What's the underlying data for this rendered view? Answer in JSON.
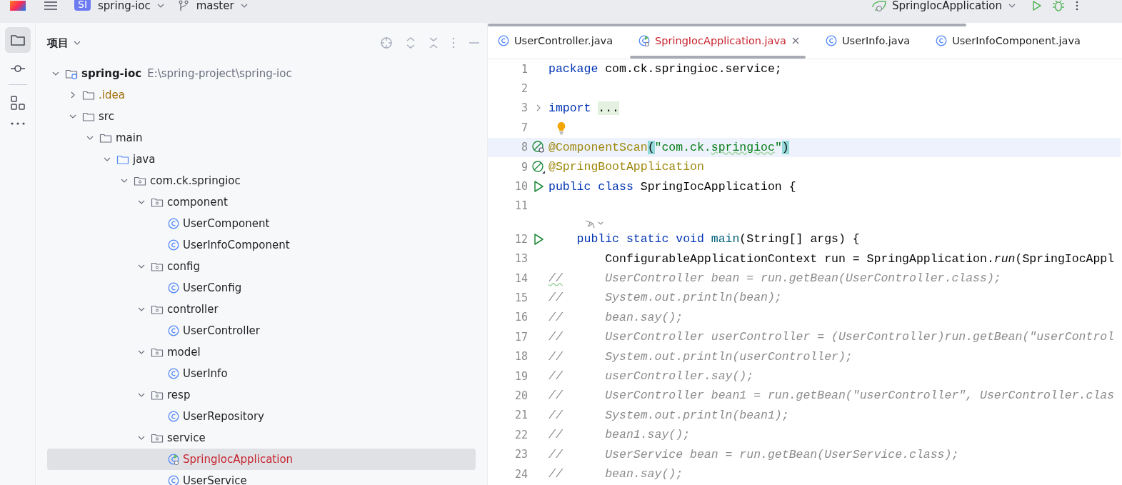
{
  "topbar": {
    "project_badge": "SI",
    "project": "spring-ioc",
    "branch": "master",
    "run_config": "SpringIocApplication"
  },
  "project_panel": {
    "title": "项目",
    "tree": [
      {
        "label": "spring-ioc",
        "kind": "module",
        "hint": "E:\\spring-project\\spring-ioc",
        "error": false,
        "ignored": false,
        "expanded": true,
        "selected": false,
        "children": [
          {
            "label": ".idea",
            "kind": "folder",
            "error": false,
            "ignored": true,
            "expanded": false,
            "selected": false
          },
          {
            "label": "src",
            "kind": "folder",
            "error": false,
            "ignored": false,
            "expanded": true,
            "selected": false,
            "children": [
              {
                "label": "main",
                "kind": "folder",
                "error": false,
                "ignored": false,
                "expanded": true,
                "selected": false,
                "children": [
                  {
                    "label": "java",
                    "kind": "source-folder",
                    "error": false,
                    "ignored": false,
                    "expanded": true,
                    "selected": false,
                    "children": [
                      {
                        "label": "com.ck.springioc",
                        "kind": "package",
                        "error": false,
                        "ignored": false,
                        "expanded": true,
                        "selected": false,
                        "children": [
                          {
                            "label": "component",
                            "kind": "package",
                            "error": false,
                            "ignored": false,
                            "expanded": true,
                            "selected": false,
                            "children": [
                              {
                                "label": "UserComponent",
                                "kind": "class",
                                "error": false,
                                "ignored": false,
                                "selected": false
                              },
                              {
                                "label": "UserInfoComponent",
                                "kind": "class",
                                "error": false,
                                "ignored": false,
                                "selected": false
                              }
                            ]
                          },
                          {
                            "label": "config",
                            "kind": "package",
                            "error": false,
                            "ignored": false,
                            "expanded": true,
                            "selected": false,
                            "children": [
                              {
                                "label": "UserConfig",
                                "kind": "class",
                                "error": false,
                                "ignored": false,
                                "selected": false
                              }
                            ]
                          },
                          {
                            "label": "controller",
                            "kind": "package",
                            "error": false,
                            "ignored": false,
                            "expanded": true,
                            "selected": false,
                            "children": [
                              {
                                "label": "UserController",
                                "kind": "class",
                                "error": false,
                                "ignored": false,
                                "selected": false
                              }
                            ]
                          },
                          {
                            "label": "model",
                            "kind": "package",
                            "error": false,
                            "ignored": false,
                            "expanded": true,
                            "selected": false,
                            "children": [
                              {
                                "label": "UserInfo",
                                "kind": "class",
                                "error": false,
                                "ignored": false,
                                "selected": false
                              }
                            ]
                          },
                          {
                            "label": "resp",
                            "kind": "package",
                            "error": false,
                            "ignored": false,
                            "expanded": true,
                            "selected": false,
                            "children": [
                              {
                                "label": "UserRepository",
                                "kind": "class",
                                "error": false,
                                "ignored": false,
                                "selected": false
                              }
                            ]
                          },
                          {
                            "label": "service",
                            "kind": "package",
                            "error": false,
                            "ignored": false,
                            "expanded": true,
                            "selected": false,
                            "children": [
                              {
                                "label": "SpringIocApplication",
                                "kind": "spring-class",
                                "error": true,
                                "ignored": false,
                                "selected": true
                              },
                              {
                                "label": "UserService",
                                "kind": "class",
                                "error": false,
                                "ignored": false,
                                "selected": false
                              }
                            ]
                          }
                        ]
                      }
                    ]
                  }
                ]
              }
            ]
          }
        ]
      }
    ]
  },
  "editor": {
    "tabs": [
      {
        "label": "UserController.java",
        "kind": "class",
        "error": false,
        "selected": false
      },
      {
        "label": "SpringIocApplication.java",
        "kind": "spring-class",
        "error": true,
        "selected": true
      },
      {
        "label": "UserInfo.java",
        "kind": "class",
        "error": false,
        "selected": false
      },
      {
        "label": "UserInfoComponent.java",
        "kind": "class",
        "error": false,
        "selected": false
      }
    ],
    "lines": [
      {
        "kind": "code",
        "number": "1",
        "current": false,
        "segments": [
          {
            "kind": "keyword",
            "text": "package"
          },
          {
            "kind": "plain",
            "text": " com.ck.springioc.service;"
          }
        ]
      },
      {
        "kind": "code",
        "number": "2",
        "current": false
      },
      {
        "kind": "code",
        "number": "3",
        "current": false,
        "gutter_icon": {
          "kind": "fold"
        },
        "segments": [
          {
            "kind": "keyword",
            "text": "import "
          },
          {
            "kind": "folded",
            "text": "..."
          }
        ]
      },
      {
        "kind": "code",
        "number": "7",
        "current": false,
        "gutter_icon": {
          "kind": "bulb"
        }
      },
      {
        "kind": "code",
        "number": "8",
        "current": true,
        "gutter_icon": {
          "kind": "bean-scan"
        },
        "segments": [
          {
            "kind": "annotation",
            "text": "@ComponentScan"
          },
          {
            "kind": "brace-match",
            "text": "("
          },
          {
            "kind": "string",
            "text": "\"com.ck."
          },
          {
            "kind": "string-typo",
            "text": "springioc"
          },
          {
            "kind": "string",
            "text": "\""
          },
          {
            "kind": "brace-match",
            "text": ")"
          }
        ]
      },
      {
        "kind": "code",
        "number": "9",
        "current": false,
        "gutter_icon": {
          "kind": "bean"
        },
        "segments": [
          {
            "kind": "annotation",
            "text": "@SpringBootApplication"
          }
        ]
      },
      {
        "kind": "code",
        "number": "10",
        "current": false,
        "gutter_icon": {
          "kind": "run"
        },
        "segments": [
          {
            "kind": "keyword",
            "text": "public class"
          },
          {
            "kind": "plain",
            "text": " SpringIocApplication {"
          }
        ]
      },
      {
        "kind": "code",
        "number": "11",
        "current": false
      },
      {
        "kind": "inlay"
      },
      {
        "kind": "code",
        "number": "12",
        "current": false,
        "gutter_icon": {
          "kind": "run"
        },
        "segments": [
          {
            "kind": "keyword",
            "text": "    public static void "
          },
          {
            "kind": "method",
            "text": "main"
          },
          {
            "kind": "plain",
            "text": "(String[] args) {"
          }
        ]
      },
      {
        "kind": "code",
        "number": "13",
        "current": false,
        "segments": [
          {
            "kind": "plain",
            "text": "        ConfigurableApplicationContext run = SpringApplication."
          },
          {
            "kind": "static-call",
            "text": "run"
          },
          {
            "kind": "plain",
            "text": "(SpringIocAppl"
          }
        ]
      },
      {
        "kind": "code",
        "number": "14",
        "current": false,
        "segments": [
          {
            "kind": "comment-typo",
            "text": "//"
          },
          {
            "kind": "comment",
            "text": "      UserController bean = run.getBean(UserController.class);"
          }
        ]
      },
      {
        "kind": "code",
        "number": "15",
        "current": false,
        "segments": [
          {
            "kind": "comment",
            "text": "//      System.out.println(bean);"
          }
        ]
      },
      {
        "kind": "code",
        "number": "16",
        "current": false,
        "segments": [
          {
            "kind": "comment",
            "text": "//      bean.say();"
          }
        ]
      },
      {
        "kind": "code",
        "number": "17",
        "current": false,
        "segments": [
          {
            "kind": "comment",
            "text": "//      UserController userController = (UserController)run.getBean(\"userControl"
          }
        ]
      },
      {
        "kind": "code",
        "number": "18",
        "current": false,
        "segments": [
          {
            "kind": "comment",
            "text": "//      System.out.println(userController);"
          }
        ]
      },
      {
        "kind": "code",
        "number": "19",
        "current": false,
        "segments": [
          {
            "kind": "comment",
            "text": "//      userController.say();"
          }
        ]
      },
      {
        "kind": "code",
        "number": "20",
        "current": false,
        "segments": [
          {
            "kind": "comment",
            "text": "//      UserController bean1 = run.getBean(\"userController\", UserController.clas"
          }
        ]
      },
      {
        "kind": "code",
        "number": "21",
        "current": false,
        "segments": [
          {
            "kind": "comment",
            "text": "//      System.out.println(bean1);"
          }
        ]
      },
      {
        "kind": "code",
        "number": "22",
        "current": false,
        "segments": [
          {
            "kind": "comment",
            "text": "//      bean1.say();"
          }
        ]
      },
      {
        "kind": "code",
        "number": "23",
        "current": false,
        "segments": [
          {
            "kind": "comment",
            "text": "//      UserService bean = run.getBean(UserService.class);"
          }
        ]
      },
      {
        "kind": "code",
        "number": "24",
        "current": false,
        "segments": [
          {
            "kind": "comment",
            "text": "//      bean.say();"
          }
        ]
      }
    ]
  }
}
